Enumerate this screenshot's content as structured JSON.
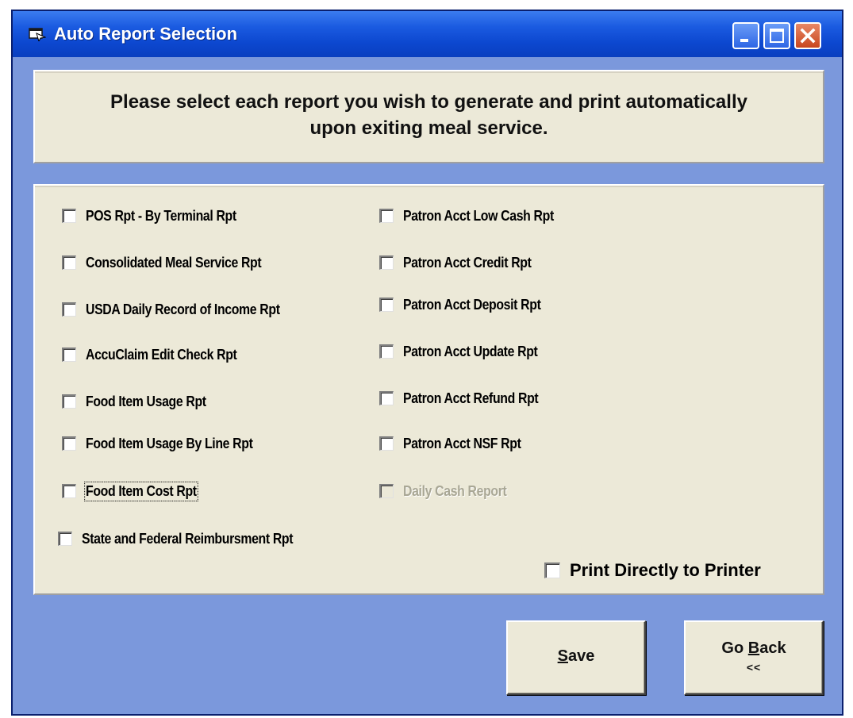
{
  "window": {
    "title": "Auto Report Selection",
    "controls": [
      "minimize-icon",
      "maximize-icon",
      "close-icon"
    ]
  },
  "instructions": {
    "line1": "Please select each report you wish to generate and print automatically",
    "line2": "upon exiting meal service."
  },
  "reports_left": [
    {
      "label": "POS Rpt - By Terminal Rpt",
      "checked": false
    },
    {
      "label": "Consolidated Meal Service Rpt",
      "checked": false
    },
    {
      "label": "USDA Daily Record of Income Rpt",
      "checked": false
    },
    {
      "label": "AccuClaim Edit Check Rpt",
      "checked": false
    },
    {
      "label": "Food Item Usage Rpt",
      "checked": false
    },
    {
      "label": "Food Item Usage By Line Rpt",
      "checked": false
    },
    {
      "label": "Food Item Cost Rpt",
      "checked": false,
      "focused": true
    },
    {
      "label": "State and Federal Reimbursment Rpt",
      "checked": false
    }
  ],
  "reports_right": [
    {
      "label": "Patron Acct Low Cash Rpt",
      "checked": false
    },
    {
      "label": "Patron Acct Credit Rpt",
      "checked": false
    },
    {
      "label": "Patron Acct Deposit Rpt",
      "checked": false
    },
    {
      "label": "Patron Acct Update Rpt",
      "checked": false
    },
    {
      "label": "Patron Acct Refund Rpt",
      "checked": false
    },
    {
      "label": "Patron Acct NSF Rpt",
      "checked": false
    },
    {
      "label": "Daily Cash Report",
      "checked": false,
      "disabled": true
    }
  ],
  "print_direct": {
    "label": "Print Directly to Printer",
    "checked": false
  },
  "buttons": {
    "save": {
      "label": "Save",
      "mnemonic": "S"
    },
    "go_back": {
      "label": "Go Back",
      "mnemonic": "B",
      "sub": "<<"
    }
  },
  "colors": {
    "titlebar": "#0c47cf",
    "window_bg": "#7b98dc",
    "panel_bg": "#ece9d8",
    "close_button": "#c8461f"
  }
}
